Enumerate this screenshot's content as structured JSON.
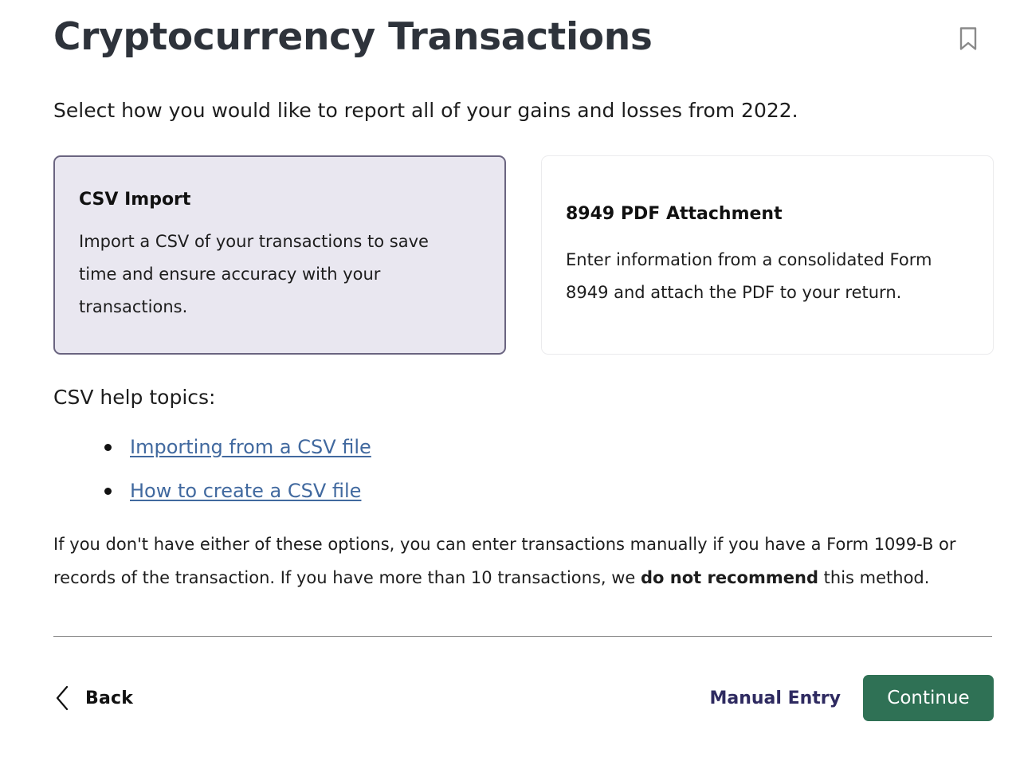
{
  "header": {
    "title": "Cryptocurrency Transactions",
    "bookmark_icon": "bookmark-icon"
  },
  "subtitle": "Select how you would like to report all of your gains and losses from 2022.",
  "options": [
    {
      "title": "CSV Import",
      "description": "Import a CSV of your transactions to save time and ensure accuracy with your transactions.",
      "selected": true
    },
    {
      "title": "8949 PDF Attachment",
      "description": "Enter information from a consolidated Form 8949 and attach the PDF to your return.",
      "selected": false
    }
  ],
  "help": {
    "heading": "CSV help topics:",
    "links": [
      "Importing from a CSV file",
      "How to create a CSV file"
    ]
  },
  "note": {
    "part1": "If you don't have either of these options, you can enter transactions manually if you have a Form 1099-B or records of the transaction. If you have more than 10 transactions, we ",
    "emphasis": "do not recommend",
    "part2": " this method."
  },
  "footer": {
    "back_label": "Back",
    "back_icon": "chevron-left-icon",
    "manual_entry_label": "Manual Entry",
    "continue_label": "Continue"
  },
  "colors": {
    "title_text": "#2e333b",
    "selected_card_bg": "#e9e7f0",
    "selected_card_border": "#6a6480",
    "card_border": "#ebebed",
    "link": "#41699f",
    "manual_entry_text": "#2e2a60",
    "continue_bg": "#2f7155",
    "divider": "#7f7f7f"
  }
}
